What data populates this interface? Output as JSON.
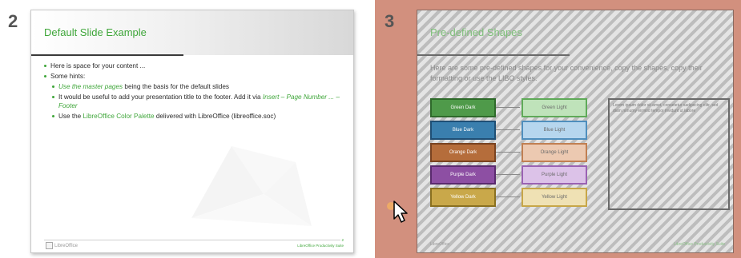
{
  "slide2": {
    "number": "2",
    "title": "Default Slide Example",
    "bullets": {
      "b1": "Here is space for your content ...",
      "b2": "Some hints:",
      "s1_link": "Use the master pages",
      "s1_text": " being the basis for the default slides",
      "s2_text": "It would be useful to add your presentation title to the footer. Add it via ",
      "s2_italic": "Insert – Page Number ... – Footer",
      "s3_pre": "Use the ",
      "s3_link": "LibreOffice Color Palette",
      "s3_post": " delivered with LibreOffice (libreoffice.soc)"
    },
    "footer_logo": "LibreOffice",
    "footer_right": "LibreOffice Productivity Suite",
    "footer_page": "2"
  },
  "slide3": {
    "number": "3",
    "title": "Pre-defined Shapes",
    "intro": "Here are some pre-defined shapes for your convenience, copy the shapes, copy their formatting or use the LIBO styles.",
    "shapes_left": [
      "Green Dark",
      "Blue Dark",
      "Orange Dark",
      "Purple Dark",
      "Yellow Dark"
    ],
    "shapes_right": [
      "Green Light",
      "Blue Light",
      "Orange Light",
      "Purple Light",
      "Yellow Light"
    ],
    "frame_text": "Lorem ipsum dolor sit amet, consetetur sadipscing elitr, sed diam nonumy eirmod tempor invidunt ut labore",
    "footer_left": "LibreOffice",
    "footer_right": "LibreOffice Productivity Suite"
  },
  "colors": {
    "accent_green": "#3fa63a",
    "selection_bg": "#d2907e"
  }
}
